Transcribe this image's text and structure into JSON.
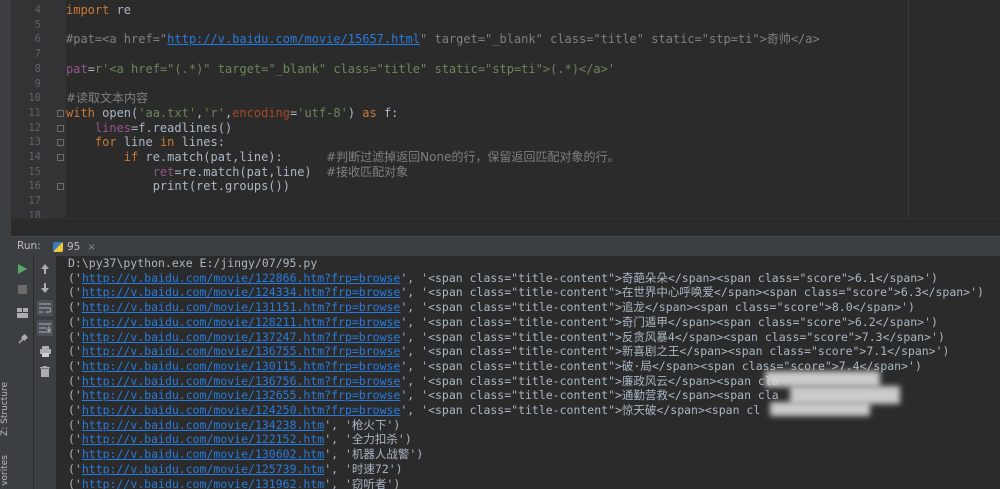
{
  "editor": {
    "lines": [
      {
        "num": "4",
        "segments": [
          {
            "c": "kw",
            "t": "import"
          },
          {
            "c": "id",
            "t": " re"
          }
        ]
      },
      {
        "num": "5",
        "segments": []
      },
      {
        "num": "6",
        "segments": [
          {
            "c": "cmt2",
            "t": "#pat=<a href=\""
          },
          {
            "c": "lnk",
            "t": "http://v.baidu.com/movie/15657.html"
          },
          {
            "c": "cmt2",
            "t": "\" target=\"_blank\" class=\"title\" static=\"stp=ti\">"
          },
          {
            "c": "cmt2 cjk",
            "t": "奇帅"
          },
          {
            "c": "cmt2",
            "t": "</a>"
          }
        ]
      },
      {
        "num": "7",
        "segments": []
      },
      {
        "num": "8",
        "segments": [
          {
            "c": "hv",
            "t": "pat"
          },
          {
            "c": "id",
            "t": "="
          },
          {
            "c": "sv",
            "t": "r'<a href=\"(.*)\" target=\"_blank\" class=\"title\" static=\"stp=ti\">(.*)</a>'"
          }
        ]
      },
      {
        "num": "9",
        "segments": []
      },
      {
        "num": "10",
        "segments": [
          {
            "c": "cmt2 cjk",
            "t": "#读取文本内容"
          }
        ]
      },
      {
        "num": "11",
        "segments": [
          {
            "c": "kw",
            "t": "with "
          },
          {
            "c": "id",
            "t": "open("
          },
          {
            "c": "sv",
            "t": "'aa.txt'"
          },
          {
            "c": "id",
            "t": ","
          },
          {
            "c": "sv",
            "t": "'r'"
          },
          {
            "c": "id",
            "t": ","
          },
          {
            "c": "param",
            "t": "encoding"
          },
          {
            "c": "id",
            "t": "="
          },
          {
            "c": "sv",
            "t": "'utf-8'"
          },
          {
            "c": "id",
            "t": ") "
          },
          {
            "c": "kw",
            "t": "as "
          },
          {
            "c": "id",
            "t": "f:"
          }
        ]
      },
      {
        "num": "12",
        "segments": [
          {
            "c": "id",
            "t": "    "
          },
          {
            "c": "hv",
            "t": "lines"
          },
          {
            "c": "id",
            "t": "=f.readlines()"
          }
        ]
      },
      {
        "num": "13",
        "segments": [
          {
            "c": "id",
            "t": "    "
          },
          {
            "c": "kw",
            "t": "for "
          },
          {
            "c": "id",
            "t": "line "
          },
          {
            "c": "kw",
            "t": "in "
          },
          {
            "c": "id",
            "t": "lines:"
          }
        ]
      },
      {
        "num": "14",
        "segments": [
          {
            "c": "id",
            "t": "        "
          },
          {
            "c": "kw",
            "t": "if "
          },
          {
            "c": "id",
            "t": "re.match(pat,line):      "
          },
          {
            "c": "cmt2 cjk",
            "t": "#判断过滤掉返回None的行，保留返回匹配对象的行。"
          }
        ]
      },
      {
        "num": "15",
        "segments": [
          {
            "c": "id",
            "t": "            "
          },
          {
            "c": "hv",
            "t": "ret"
          },
          {
            "c": "id",
            "t": "=re.match(pat,line)  "
          },
          {
            "c": "cmt2 cjk",
            "t": "#接收匹配对象"
          }
        ]
      },
      {
        "num": "16",
        "segments": [
          {
            "c": "id",
            "t": "            print(ret.groups())"
          }
        ]
      },
      {
        "num": "17",
        "segments": []
      },
      {
        "num": "18",
        "segments": []
      }
    ]
  },
  "run_panel": {
    "label": "Run:",
    "tab_name": "95",
    "tab_close": "×"
  },
  "side_labels": {
    "structure": "Z: Structure",
    "favorites": "vorites"
  },
  "console": {
    "command": "D:\\py37\\python.exe E:/jingy/07/95.py",
    "rows": [
      {
        "pre": "('",
        "url": "http://v.baidu.com/movie/122866.htm?frp=browse",
        "mid": "', '",
        "text": "<span class=\"title-content\">奇葩朵朵</span><span class=\"score\">6.1</span>')"
      },
      {
        "pre": "('",
        "url": "http://v.baidu.com/movie/124334.htm?frp=browse",
        "mid": "', '",
        "text": "<span class=\"title-content\">在世界中心呼唤爱</span><span class=\"score\">6.3</span>')"
      },
      {
        "pre": "('",
        "url": "http://v.baidu.com/movie/131151.htm?frp=browse",
        "mid": "', '",
        "text": "<span class=\"title-content\">追龙</span><span class=\"score\">8.0</span>')"
      },
      {
        "pre": "('",
        "url": "http://v.baidu.com/movie/128211.htm?frp=browse",
        "mid": "', '",
        "text": "<span class=\"title-content\">奇门遁甲</span><span class=\"score\">6.2</span>')"
      },
      {
        "pre": "('",
        "url": "http://v.baidu.com/movie/137247.htm?frp=browse",
        "mid": "', '",
        "text": "<span class=\"title-content\">反贪风暴4</span><span class=\"score\">7.3</span>')"
      },
      {
        "pre": "('",
        "url": "http://v.baidu.com/movie/136755.htm?frp=browse",
        "mid": "', '",
        "text": "<span class=\"title-content\">新喜剧之王</span><span class=\"score\">7.1</span>')"
      },
      {
        "pre": "('",
        "url": "http://v.baidu.com/movie/130115.htm?frp=browse",
        "mid": "', '",
        "text": "<span class=\"title-content\">破·局</span><span class=\"score\">7.4</span>')"
      },
      {
        "pre": "('",
        "url": "http://v.baidu.com/movie/136756.htm?frp=browse",
        "mid": "', '",
        "text": "<span class=\"title-content\">廉政风云</span><span cla"
      },
      {
        "pre": "('",
        "url": "http://v.baidu.com/movie/132655.htm?frp=browse",
        "mid": "', '",
        "text": "<span class=\"title-content\">通勤营救</span><span cla"
      },
      {
        "pre": "('",
        "url": "http://v.baidu.com/movie/124250.htm?frp=browse",
        "mid": "', '",
        "text": "<span class=\"title-content\">惊天破</span><span cl"
      },
      {
        "pre": "('",
        "url": "http://v.baidu.com/movie/134238.htm",
        "mid": "', '",
        "text": "枪火下')"
      },
      {
        "pre": "('",
        "url": "http://v.baidu.com/movie/122152.htm",
        "mid": "', '",
        "text": "全力扣杀')"
      },
      {
        "pre": "('",
        "url": "http://v.baidu.com/movie/130602.htm",
        "mid": "', '",
        "text": "机器人战警')"
      },
      {
        "pre": "('",
        "url": "http://v.baidu.com/movie/125739.htm",
        "mid": "', '",
        "text": "时速72')"
      },
      {
        "pre": "('",
        "url": "http://v.baidu.com/movie/131962.htm",
        "mid": "', '",
        "text": "窃听者')"
      }
    ]
  },
  "toolbar_left": {
    "run_icon": "play-icon",
    "stop_icon": "stop-icon",
    "layout_icon": "layout-icon",
    "pin_icon": "pin-icon"
  },
  "toolbar_right": {
    "up_icon": "arrow-up-icon",
    "down_icon": "arrow-down-icon",
    "wrap_icon": "soft-wrap-icon",
    "scroll_icon": "scroll-to-end-icon",
    "print_icon": "print-icon",
    "trash_icon": "trash-icon"
  },
  "colors": {
    "background": "#2b2b2b",
    "link": "#287bde",
    "keyword": "#cc7832",
    "string": "#6a8759",
    "run_green": "#59a869"
  }
}
